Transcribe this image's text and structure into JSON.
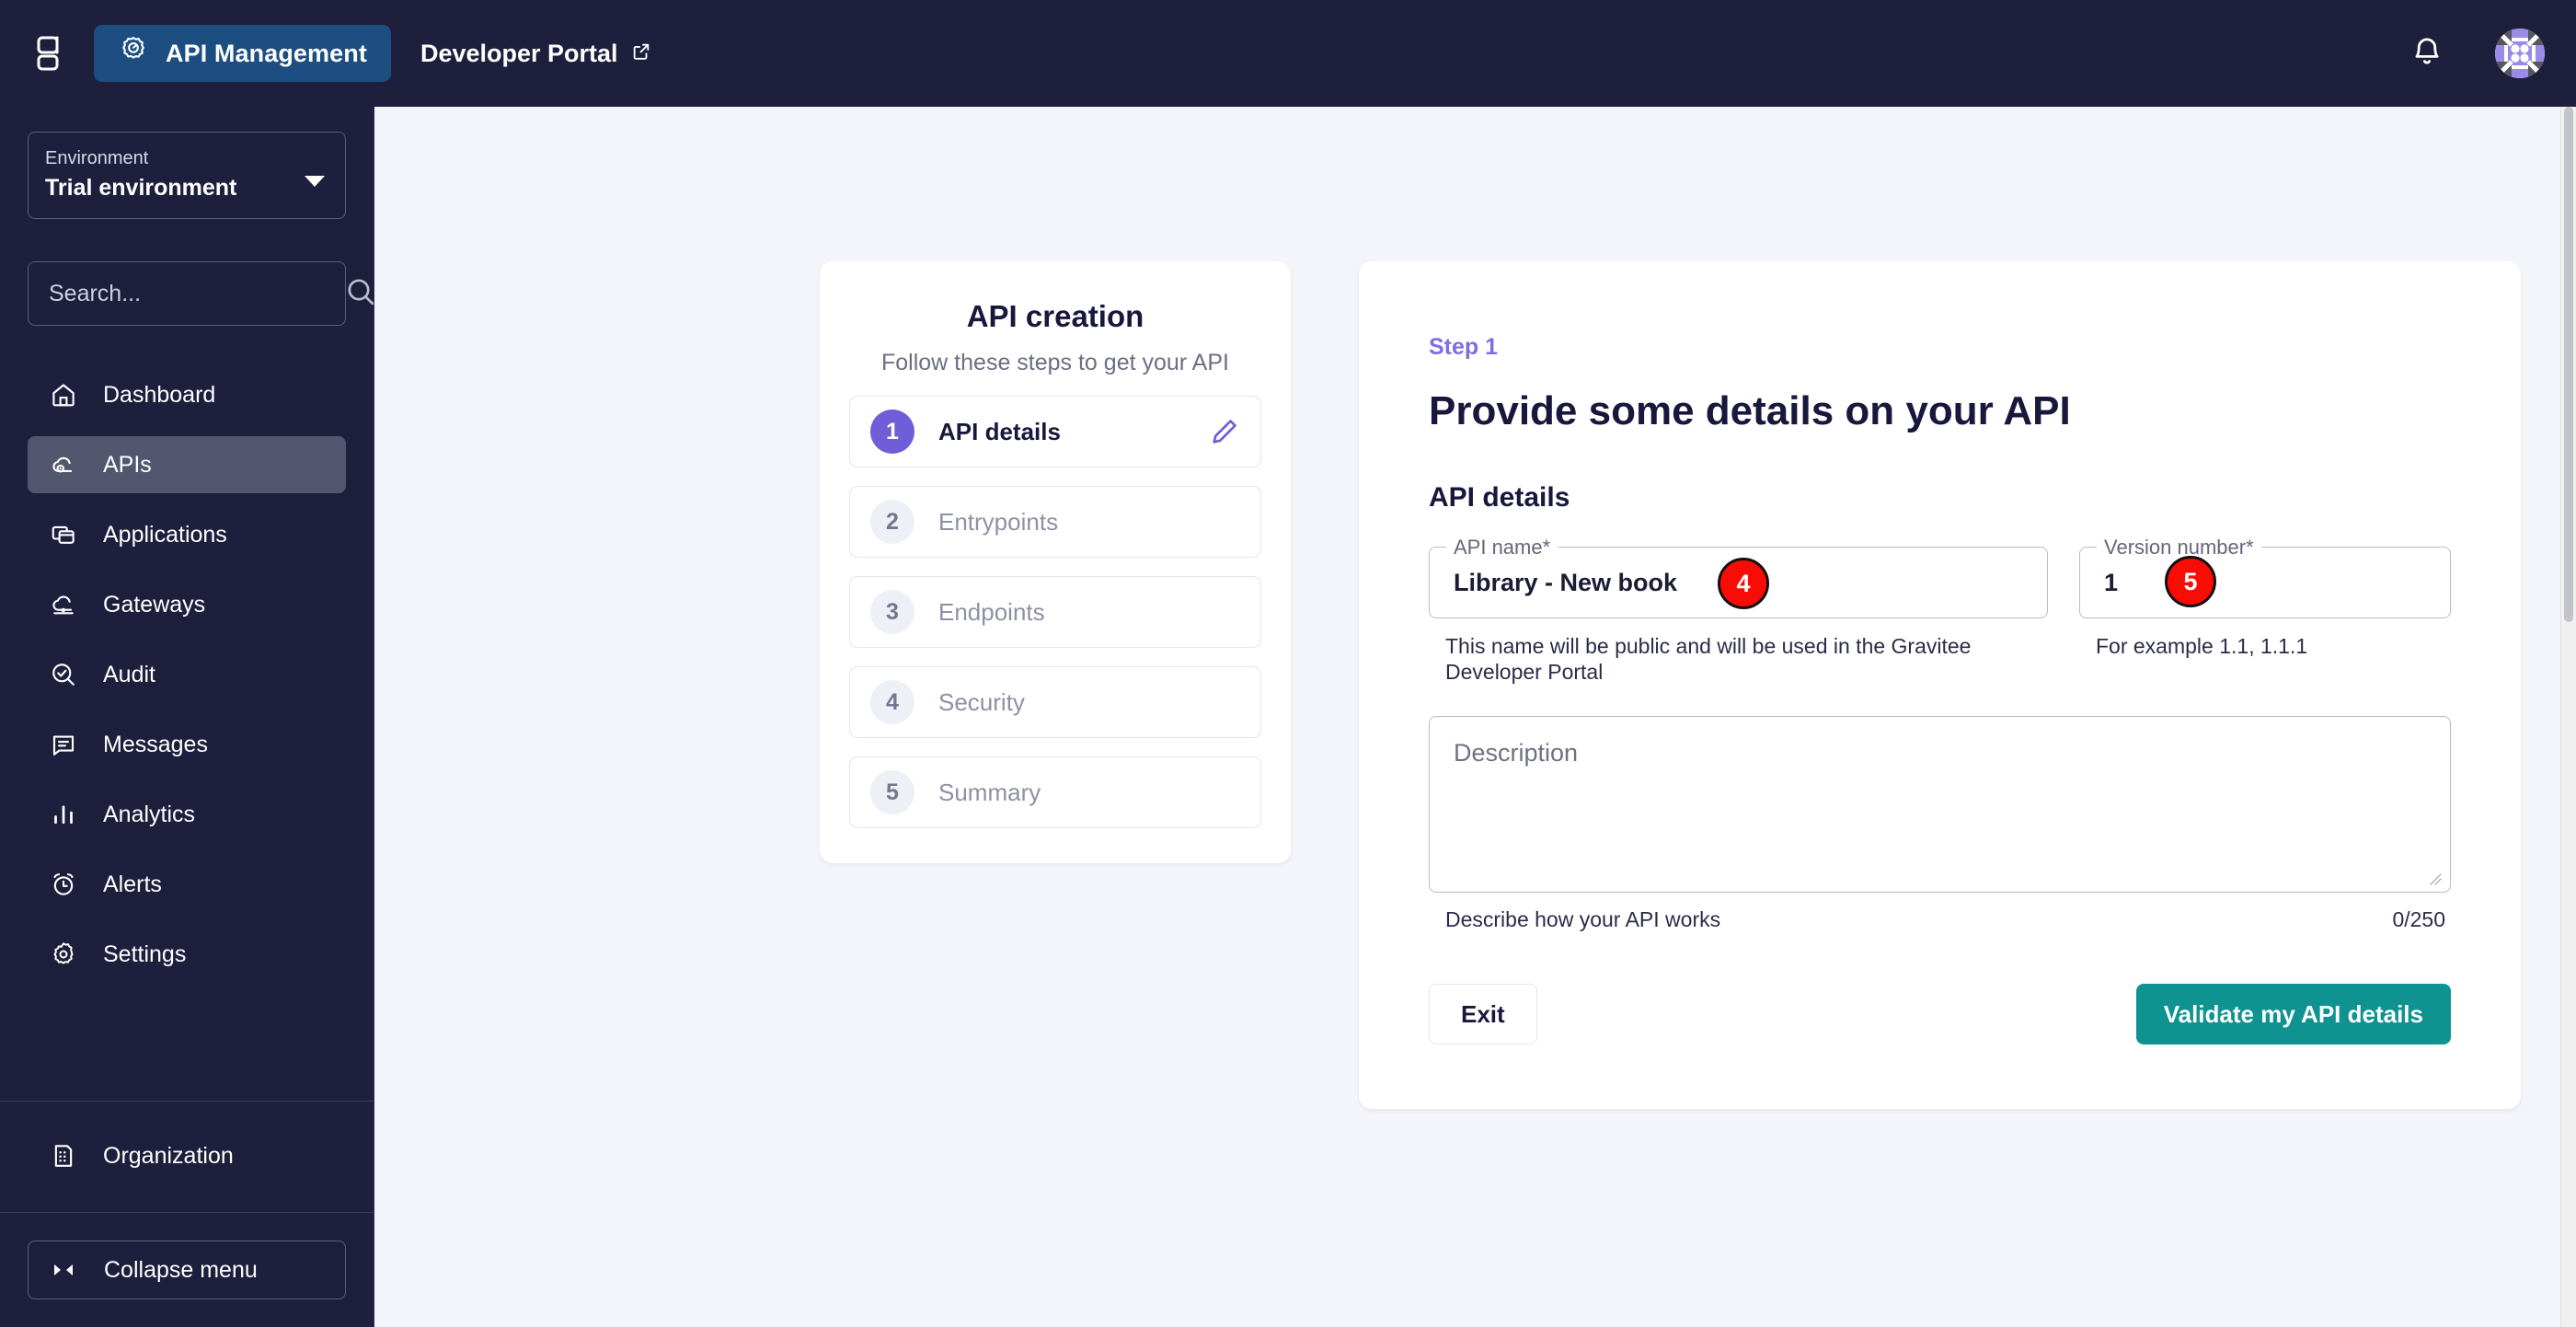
{
  "topbar": {
    "logo": "gravitee-g-logo",
    "primary_nav_label": "API Management",
    "primary_nav_icon": "api-gear-badge-icon",
    "secondary_nav_label": "Developer Portal",
    "secondary_nav_icon": "external-link-icon",
    "bell_icon": "notification-bell-icon",
    "avatar_icon": "user-avatar"
  },
  "sidebar": {
    "environment": {
      "label": "Environment",
      "value": "Trial environment",
      "caret_icon": "chevron-down-icon"
    },
    "search": {
      "placeholder": "Search...",
      "value": "",
      "icon": "search-icon"
    },
    "items": [
      {
        "label": "Dashboard",
        "icon": "home-icon",
        "active": false
      },
      {
        "label": "APIs",
        "icon": "cloud-gear-icon",
        "active": true
      },
      {
        "label": "Applications",
        "icon": "windows-icon",
        "active": false
      },
      {
        "label": "Gateways",
        "icon": "cloud-plug-icon",
        "active": false
      },
      {
        "label": "Audit",
        "icon": "search-check-icon",
        "active": false
      },
      {
        "label": "Messages",
        "icon": "message-icon",
        "active": false
      },
      {
        "label": "Analytics",
        "icon": "bar-chart-icon",
        "active": false
      },
      {
        "label": "Alerts",
        "icon": "alarm-clock-icon",
        "active": false
      },
      {
        "label": "Settings",
        "icon": "gear-icon",
        "active": false
      }
    ],
    "organization": {
      "label": "Organization",
      "icon": "building-icon"
    },
    "collapse": {
      "label": "Collapse menu",
      "icon": "collapse-arrows-icon"
    }
  },
  "steps_panel": {
    "title": "API creation",
    "subtitle": "Follow these steps to get your API",
    "edit_icon": "pencil-icon",
    "steps": [
      {
        "number": "1",
        "label": "API details",
        "active": true,
        "editable": true
      },
      {
        "number": "2",
        "label": "Entrypoints",
        "active": false,
        "editable": false
      },
      {
        "number": "3",
        "label": "Endpoints",
        "active": false,
        "editable": false
      },
      {
        "number": "4",
        "label": "Security",
        "active": false,
        "editable": false
      },
      {
        "number": "5",
        "label": "Summary",
        "active": false,
        "editable": false
      }
    ]
  },
  "form": {
    "eyebrow": "Step 1",
    "heading": "Provide some details on your API",
    "section_title": "API details",
    "api_name": {
      "legend": "API name*",
      "value": "Library - New book",
      "hint": "This name will be public and will be used in the Gravitee Developer Portal"
    },
    "version": {
      "legend": "Version number*",
      "value": "1",
      "hint": "For example 1.1, 1.1.1"
    },
    "description": {
      "placeholder": "Description",
      "value": "",
      "hint": "Describe how your API works",
      "counter": "0/250",
      "resize_icon": "resize-grip-icon"
    },
    "exit_label": "Exit",
    "submit_label": "Validate my API details"
  },
  "annotations": [
    {
      "id": "4",
      "target": "api-name-field"
    },
    {
      "id": "5",
      "target": "version-number-field"
    }
  ],
  "colors": {
    "sidebar_bg": "#1e1f3d",
    "nav_pill": "#1d4e82",
    "accent_purple": "#6f5ed8",
    "primary_teal": "#0e9390",
    "page_bg": "#f4f5fa",
    "marker_red": "#fb0b06"
  }
}
